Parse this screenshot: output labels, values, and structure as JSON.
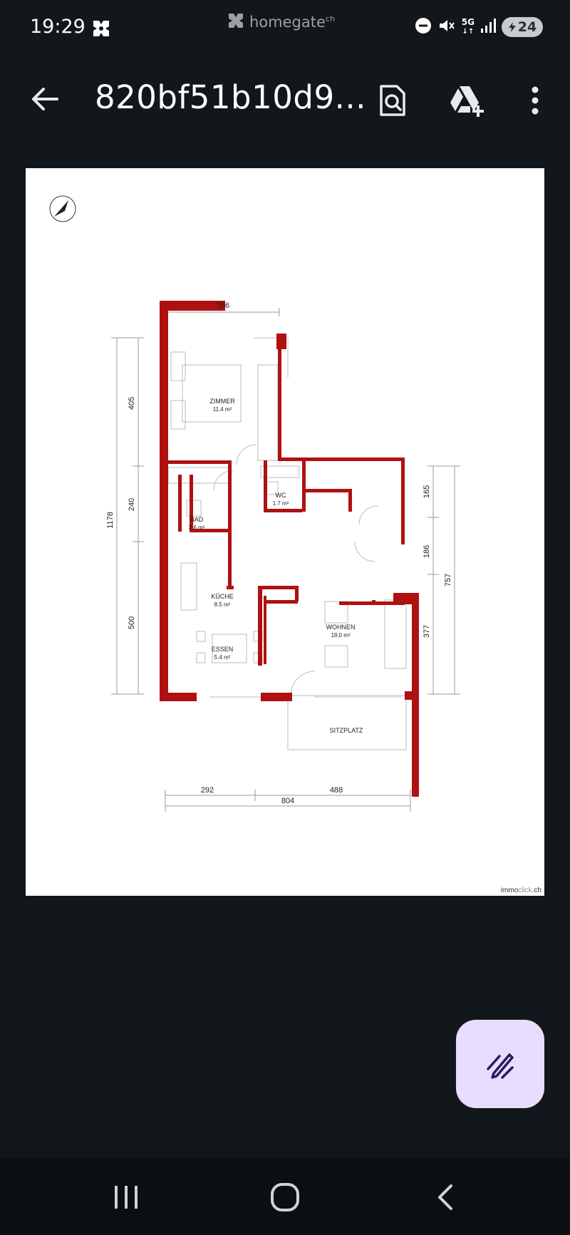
{
  "status_bar": {
    "time": "19:29",
    "app_name": "homegate",
    "app_name_suffix": "ch",
    "network": "5G",
    "battery": "24",
    "icons": [
      "notification-icon",
      "dnd-icon",
      "mute-icon",
      "signal-icon",
      "battery-icon"
    ]
  },
  "app_bar": {
    "title": "820bf51b10d9...",
    "back_icon": "arrow-left-icon",
    "actions": [
      "search-document-icon",
      "add-to-drive-icon",
      "more-vert-icon"
    ]
  },
  "floor_plan": {
    "rooms": [
      {
        "name": "ZIMMER",
        "area": "11.4 m²"
      },
      {
        "name": "WC",
        "area": "1.7 m²"
      },
      {
        "name": "BAD",
        "area": "3.6 m²"
      },
      {
        "name": "KÜCHE",
        "area": "8.5 m²"
      },
      {
        "name": "ESSEN",
        "area": "5.4 m²"
      },
      {
        "name": "WOHNEN",
        "area": "18.0 m²"
      },
      {
        "name": "SITZPLATZ",
        "area": ""
      }
    ],
    "dimensions": {
      "top": "356",
      "left_total": "1178",
      "left_segments": [
        "405",
        "240",
        "500"
      ],
      "right_segments": [
        "165",
        "186",
        "377"
      ],
      "right_total": "757",
      "bottom_segments": [
        "292",
        "488"
      ],
      "bottom_total": "804"
    },
    "watermark_main": "immo",
    "watermark_accent": "click",
    "watermark_suffix": ".ch",
    "wall_color": "#b01010"
  },
  "fab": {
    "icon": "edit-pen-icon"
  },
  "nav_bar": {
    "buttons": [
      "recent-apps-icon",
      "home-icon",
      "back-icon"
    ]
  }
}
